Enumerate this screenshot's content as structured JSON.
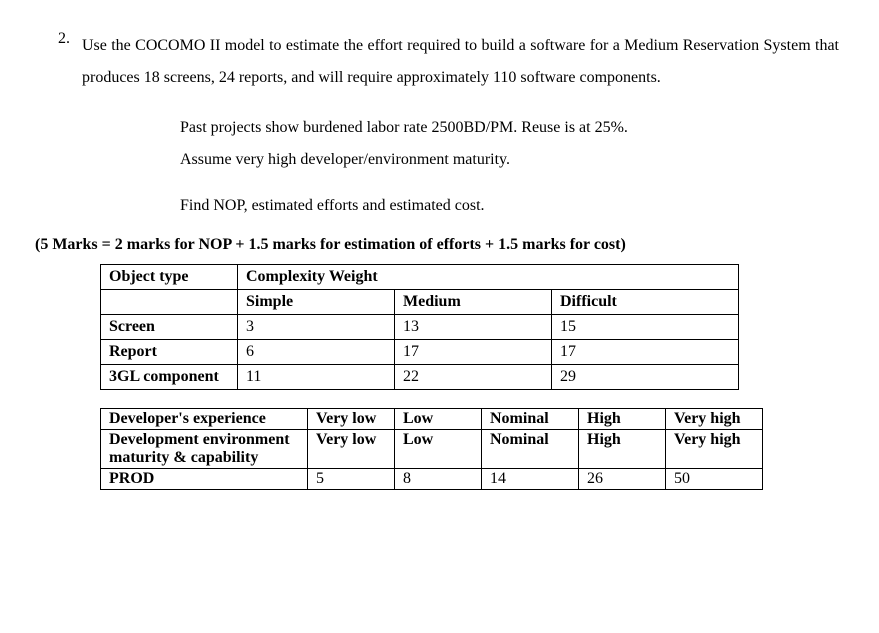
{
  "question": {
    "number": "2.",
    "prompt": "Use the COCOMO II model to estimate the effort required to build a software for a Medium Reservation System that produces 18 screens, 24 reports, and will require approximately 110 software components.",
    "details_line1": "Past projects show burdened labor rate 2500BD/PM. Reuse is at 25%.",
    "details_line2": "Assume very high developer/environment maturity.",
    "task": "Find NOP, estimated efforts and estimated cost.",
    "marks": "(5 Marks = 2 marks for NOP + 1.5 marks for estimation of efforts + 1.5 marks for  cost)"
  },
  "table1": {
    "header_col1": "Object type",
    "header_col2": "Complexity Weight",
    "sub_simple": "Simple",
    "sub_medium": "Medium",
    "sub_difficult": "Difficult",
    "rows": [
      {
        "name": "Screen",
        "simple": "3",
        "medium": "13",
        "difficult": "15"
      },
      {
        "name": "Report",
        "simple": "6",
        "medium": "17",
        "difficult": "17"
      },
      {
        "name": "3GL component",
        "simple": "11",
        "medium": "22",
        "difficult": "29"
      }
    ]
  },
  "table2": {
    "rows": [
      {
        "c1": "Developer's experience",
        "c2": "Very low",
        "c3": "Low",
        "c4": "Nominal",
        "c5": "High",
        "c6": "Very high"
      },
      {
        "c1": "Development environment maturity & capability",
        "c2": "Very low",
        "c3": "Low",
        "c4": "Nominal",
        "c5": "High",
        "c6": "Very high"
      },
      {
        "c1": "PROD",
        "c2": "5",
        "c3": "8",
        "c4": "14",
        "c5": "26",
        "c6": "50"
      }
    ]
  }
}
